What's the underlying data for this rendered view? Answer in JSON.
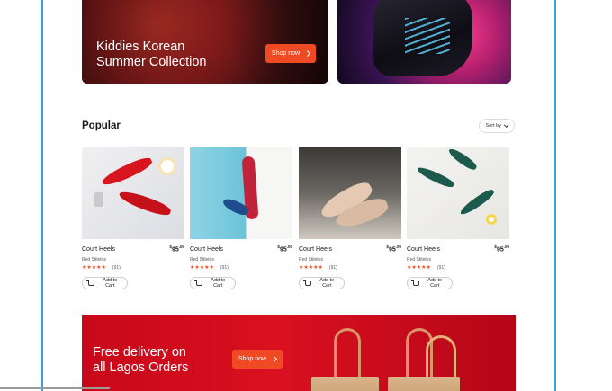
{
  "hero": {
    "title_line1": "Kiddies Korean",
    "title_line2": "Summer Collection",
    "button": "Shop now"
  },
  "popular": {
    "title": "Popular",
    "sort_label": "Sort by",
    "products": [
      {
        "name": "Court Heels",
        "price": "95",
        "price_cents": ".00",
        "price_symbol": "$",
        "brand": "Red Stiletos",
        "rating_count": "(91)",
        "button": "Add to Cart"
      },
      {
        "name": "Court Heels",
        "price": "95",
        "price_cents": ".00",
        "price_symbol": "$",
        "brand": "Red Stiletos",
        "rating_count": "(91)",
        "button": "Add to Cart"
      },
      {
        "name": "Court Heels",
        "price": "95",
        "price_cents": ".00",
        "price_symbol": "$",
        "brand": "Red Stiletos",
        "rating_count": "(91)",
        "button": "Add to Cart"
      },
      {
        "name": "Court Heels",
        "price": "95",
        "price_cents": ".00",
        "price_symbol": "$",
        "brand": "Red Stiletos",
        "rating_count": "(91)",
        "button": "Add to Cart"
      }
    ],
    "stars": "★★★★★"
  },
  "delivery": {
    "title_line1": "Free delivery on",
    "title_line2": "all Lagos Orders",
    "button": "Shop now"
  },
  "colors": {
    "accent": "#f04a24",
    "banner_red": "#d9101f",
    "frame": "#3fa0d8"
  }
}
